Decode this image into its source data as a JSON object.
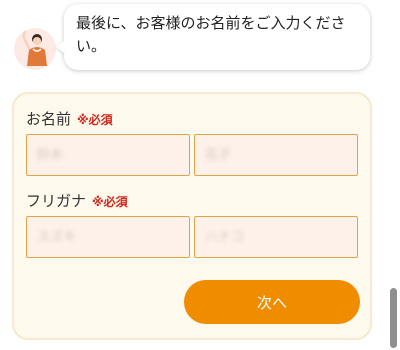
{
  "chat": {
    "message": "最後に、お客様のお名前をご入力ください。"
  },
  "form": {
    "name_label": "お名前",
    "kana_label": "フリガナ",
    "required_mark": "※必須",
    "last_name_placeholder": "鈴木",
    "first_name_placeholder": "花子",
    "last_name_kana_placeholder": "スズキ",
    "first_name_kana_placeholder": "ハナコ",
    "next_button_label": "次へ"
  },
  "colors": {
    "accent": "#f08c00",
    "required": "#d12a1d",
    "card_background": "#fdf9ec",
    "input_background": "#fdf1ea",
    "input_border": "#e0a54a"
  }
}
